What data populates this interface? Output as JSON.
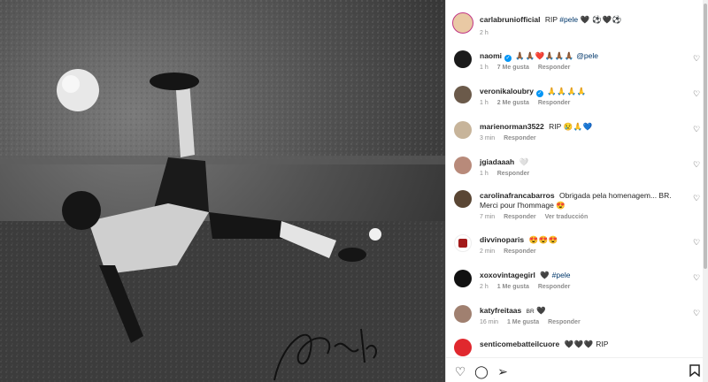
{
  "post": {
    "author": "carlabruniofficial",
    "caption_text": "RIP",
    "caption_hashtag": "#pele",
    "caption_emojis": "🖤 ⚽🖤⚽",
    "time": "2 h"
  },
  "photo": {
    "signature": "Pelé"
  },
  "comments": [
    {
      "user": "naomi",
      "verified": true,
      "text": "",
      "emojis": "🙏🏾🙏🏾❤️🙏🏾🙏🏾🙏🏾",
      "mention": "@pele",
      "time": "1 h",
      "likes": "7 Me gusta",
      "reply": "Responder",
      "extra": ""
    },
    {
      "user": "veronikaloubry",
      "verified": true,
      "text": "",
      "emojis": "🙏🙏🙏🙏",
      "mention": "",
      "time": "1 h",
      "likes": "2 Me gusta",
      "reply": "Responder",
      "extra": ""
    },
    {
      "user": "marienorman3522",
      "verified": false,
      "text": "RIP",
      "emojis": "😢🙏💙",
      "mention": "",
      "time": "3 min",
      "likes": "",
      "reply": "Responder",
      "extra": ""
    },
    {
      "user": "jgiadaaah",
      "verified": false,
      "text": "",
      "emojis": "🤍",
      "mention": "",
      "time": "1 h",
      "likes": "",
      "reply": "Responder",
      "extra": ""
    },
    {
      "user": "carolinafrancabarros",
      "verified": false,
      "text": "Obrigada pela homenagem... BR. Merci pour l'hommage",
      "emojis": "😍",
      "mention": "",
      "time": "7 min",
      "likes": "",
      "reply": "Responder",
      "extra": "Ver traducción"
    },
    {
      "user": "divvinoparis",
      "verified": false,
      "text": "",
      "emojis": "😍😍😍",
      "mention": "",
      "time": "2 min",
      "likes": "",
      "reply": "Responder",
      "extra": ""
    },
    {
      "user": "xoxovintagegirl",
      "verified": false,
      "text": "",
      "emojis": "🖤",
      "mention": "#pele",
      "time": "2 h",
      "likes": "1 Me gusta",
      "reply": "Responder",
      "extra": ""
    },
    {
      "user": "katyfreitaas",
      "verified": false,
      "text": "BR",
      "emojis": "🖤",
      "mention": "",
      "time": "16 min",
      "likes": "1 Me gusta",
      "reply": "Responder",
      "extra": ""
    },
    {
      "user": "senticomebatteilcuore",
      "verified": false,
      "text": "RIP",
      "emojis": "🖤🖤🖤",
      "mention": "",
      "time": "",
      "likes": "",
      "reply": "",
      "extra": ""
    }
  ],
  "icons": {
    "like": "heart-icon",
    "comment": "comment-icon",
    "share": "paper-plane-icon",
    "save": "bookmark-icon"
  }
}
